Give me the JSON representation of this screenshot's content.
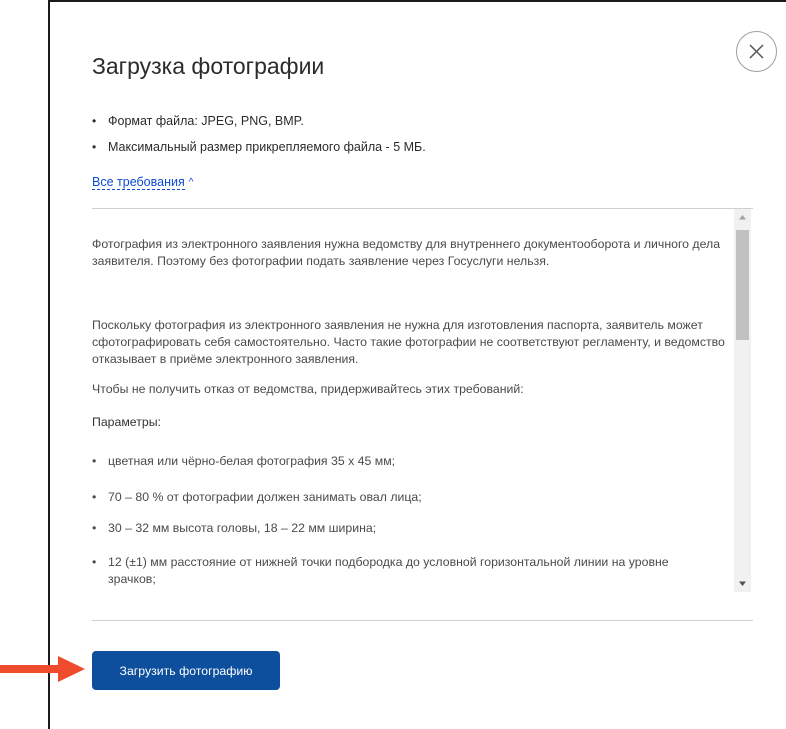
{
  "dialog": {
    "title": "Загрузка фотографии",
    "close_icon": "close-icon"
  },
  "requirements_summary": [
    "Формат файла: JPEG, PNG, BMP.",
    "Максимальный размер прикрепляемого файла - 5 МБ."
  ],
  "toggle": {
    "label": "Все требования",
    "chevron": "^",
    "icon": "chevron-up-icon"
  },
  "details": {
    "paragraphs": [
      "Фотография из электронного заявления нужна ведомству для внутреннего документооборота и личного дела заявителя. Поэтому без фотографии подать заявление через Госуслуги нельзя.",
      "Поскольку фотография из электронного заявления не нужна для изготовления паспорта, заявитель может сфотографировать себя самостоятельно. Часто такие фотографии не соответствуют регламенту, и ведомство отказывает в приёме электронного заявления.",
      "Чтобы не получить отказ от ведомства, придерживайтесь этих требований:"
    ],
    "params_heading": "Параметры:",
    "params": [
      "цветная или чёрно-белая фотография 35 х 45 мм;",
      "70 – 80 % от фотографии должен занимать овал лица;",
      "30 – 32 мм высота головы, 18 – 22 мм ширина;",
      "12 (±1) мм расстояние от нижней точки подбородка до условной горизонтальной линии на уровне зрачков;"
    ]
  },
  "actions": {
    "upload_label": "Загрузить фотографию"
  },
  "colors": {
    "primary_button": "#0d4f9c",
    "link": "#0d4cd3",
    "arrow": "#ee4c2c"
  }
}
